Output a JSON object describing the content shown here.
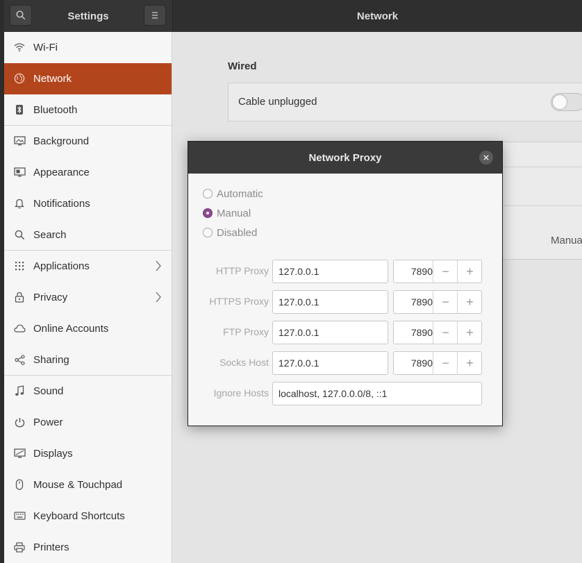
{
  "header": {
    "app_title": "Settings",
    "panel_title": "Network"
  },
  "sidebar": {
    "items": [
      {
        "label": "Wi-Fi",
        "icon": "wifi-icon"
      },
      {
        "label": "Network",
        "icon": "network-icon"
      },
      {
        "label": "Bluetooth",
        "icon": "bluetooth-icon"
      },
      {
        "label": "Background",
        "icon": "background-icon"
      },
      {
        "label": "Appearance",
        "icon": "appearance-icon"
      },
      {
        "label": "Notifications",
        "icon": "bell-icon"
      },
      {
        "label": "Search",
        "icon": "search-icon"
      },
      {
        "label": "Applications",
        "icon": "grid-icon"
      },
      {
        "label": "Privacy",
        "icon": "lock-icon"
      },
      {
        "label": "Online Accounts",
        "icon": "cloud-icon"
      },
      {
        "label": "Sharing",
        "icon": "share-icon"
      },
      {
        "label": "Sound",
        "icon": "music-note-icon"
      },
      {
        "label": "Power",
        "icon": "power-icon"
      },
      {
        "label": "Displays",
        "icon": "display-icon"
      },
      {
        "label": "Mouse & Touchpad",
        "icon": "mouse-icon"
      },
      {
        "label": "Keyboard Shortcuts",
        "icon": "keyboard-icon"
      },
      {
        "label": "Printers",
        "icon": "printer-icon"
      }
    ],
    "active_color": "#b3451d"
  },
  "main": {
    "wired_title": "Wired",
    "cable_status": "Cable unplugged",
    "proxy_value_partial": "Manua"
  },
  "dialog": {
    "title": "Network Proxy",
    "modes": {
      "automatic": "Automatic",
      "manual": "Manual",
      "disabled": "Disabled",
      "selected": "Manual"
    },
    "proxies": [
      {
        "label": "HTTP Proxy",
        "host": "127.0.0.1",
        "port": "7890"
      },
      {
        "label": "HTTPS Proxy",
        "host": "127.0.0.1",
        "port": "7890"
      },
      {
        "label": "FTP Proxy",
        "host": "127.0.0.1",
        "port": "7890"
      },
      {
        "label": "Socks Host",
        "host": "127.0.0.1",
        "port": "7890"
      }
    ],
    "ignore_hosts": {
      "label": "Ignore Hosts",
      "value": "localhost, 127.0.0.0/8, ::1"
    },
    "spin_minus": "−",
    "spin_plus": "+",
    "accent": "#8b4a8e"
  }
}
